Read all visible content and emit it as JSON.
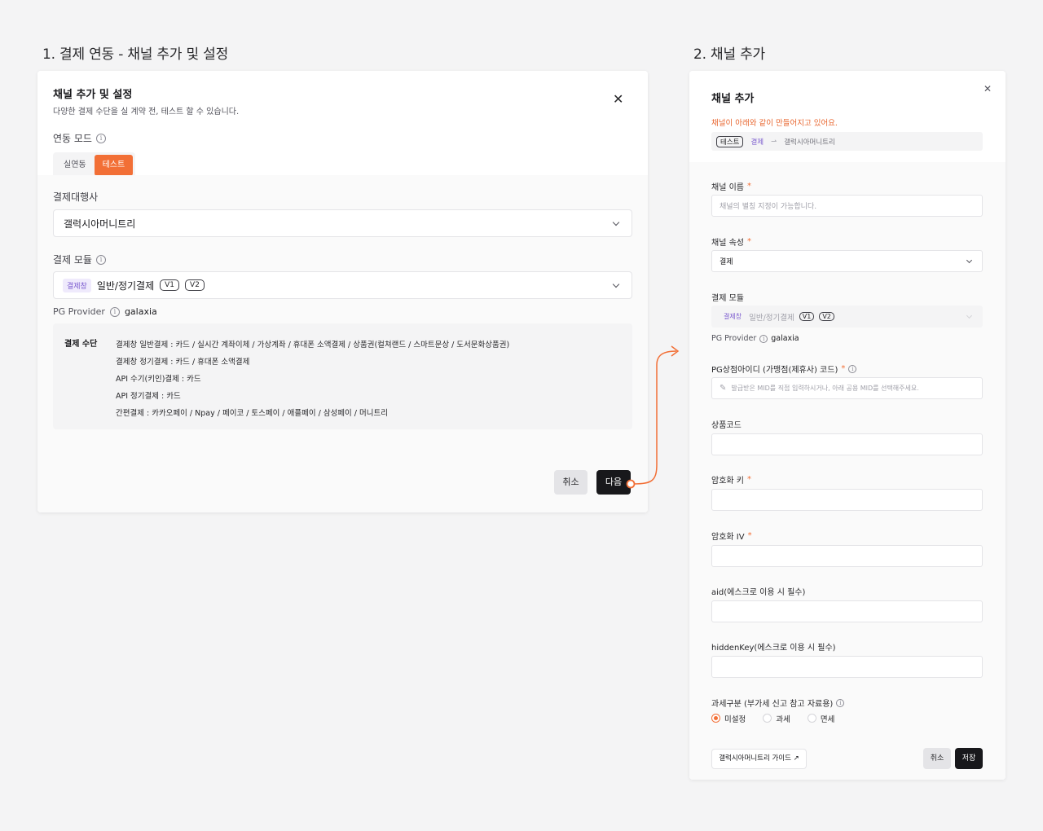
{
  "steps": {
    "step1_title": "1. 결제 연동 - 채널 추가 및 설정",
    "step2_title": "2. 채널 추가"
  },
  "left": {
    "title": "채널 추가 및 설정",
    "subtitle": "다양한 결제 수단을 실 계약 전, 테스트 할 수 있습니다.",
    "mode_label": "연동 모드",
    "mode_options": [
      "실연동",
      "테스트"
    ],
    "mode_selected": "테스트",
    "pg_label": "결제대행사",
    "pg_value": "갤럭시아머니트리",
    "module_label": "결제 모듈",
    "module_badge": "결제창",
    "module_value": "일반/정기결제",
    "module_pills": [
      "V1",
      "V2"
    ],
    "provider_label": "PG Provider",
    "provider_value": "galaxia",
    "methods_title": "결제 수단",
    "methods_lines": [
      "결제창 일반결제 : 카드 / 실시간 계좌이체 / 가상계좌 / 휴대폰 소액결제 / 상품권(컬쳐랜드 / 스마트문상 / 도서문화상품권)",
      "결제창 정기결제 : 카드 / 휴대폰 소액결제",
      "API 수기(키인)결제 : 카드",
      "API 정기결제 : 카드",
      "간편결제 : 카카오페이 / Npay / 페이코 / 토스페이 / 애플페이 / 삼성페이 / 머니트리"
    ],
    "cancel_label": "취소",
    "next_label": "다음"
  },
  "right": {
    "title": "채널 추가",
    "notice": "채널이 아래와 같이 만들어지고 있어요.",
    "preview_tag": "테스트",
    "preview_type": "결제",
    "preview_name": "갤럭시아머니트리",
    "channel_name_label": "채널 이름",
    "channel_name_placeholder": "채널의 별칭 지정이 가능합니다.",
    "channel_attr_label": "채널 속성",
    "channel_attr_value": "결제",
    "module_label": "결제 모듈",
    "module_badge": "결제창",
    "module_value": "일반/정기결제",
    "module_pills": [
      "V1",
      "V2"
    ],
    "provider_label": "PG Provider",
    "provider_value": "galaxia",
    "mid_label": "PG상점아이디 (가맹점(제휴사) 코드)",
    "mid_placeholder": "발급받은 MID를 직접 입력하시거나, 아래 공용 MID를 선택해주세요.",
    "product_code_label": "상품코드",
    "enc_key_label": "암호화 키",
    "enc_iv_label": "암호화 IV",
    "aid_label": "aid(에스크로 이용 시 필수)",
    "hidden_key_label": "hiddenKey(에스크로 이용 시 필수)",
    "tax_label": "과세구분 (부가세 신고 참고 자료용)",
    "tax_options": [
      "미설정",
      "과세",
      "면세"
    ],
    "tax_selected": "미설정",
    "guide_label": "갤럭시아머니트리 가이드 ↗",
    "cancel_label": "취소",
    "save_label": "저장"
  },
  "colors": {
    "accent": "#f26f36",
    "dark": "#18181b",
    "purple": "#7c5ccf"
  }
}
